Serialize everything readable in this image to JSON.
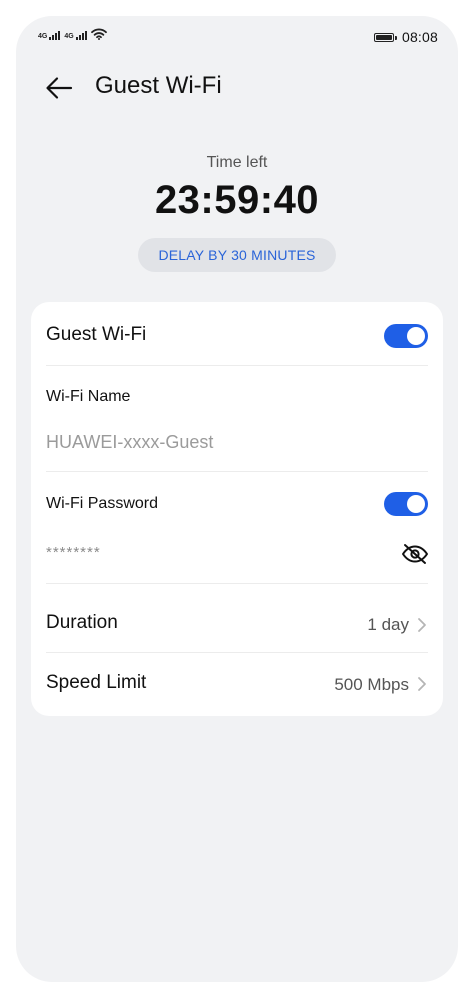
{
  "status_bar": {
    "signal_1": "4G",
    "signal_2": "4G",
    "time": "08:08"
  },
  "header": {
    "title": "Guest Wi-Fi",
    "back_icon": "arrow-left-icon"
  },
  "timer": {
    "label": "Time left",
    "value": "23:59:40",
    "delay_button": "DELAY BY 30 MINUTES"
  },
  "settings": {
    "guest_wifi": {
      "label": "Guest Wi-Fi",
      "enabled": true
    },
    "wifi_name": {
      "label": "Wi-Fi Name",
      "value": "HUAWEI-xxxx-Guest"
    },
    "wifi_password": {
      "label": "Wi-Fi Password",
      "enabled": true,
      "value": "********",
      "visibility_icon": "eye-off-icon"
    },
    "duration": {
      "label": "Duration",
      "value": "1 day"
    },
    "speed_limit": {
      "label": "Speed Limit",
      "value": "500 Mbps"
    }
  },
  "colors": {
    "accent": "#1f5fe6",
    "link": "#2a64d8",
    "background": "#f1f2f4",
    "card": "#ffffff"
  }
}
